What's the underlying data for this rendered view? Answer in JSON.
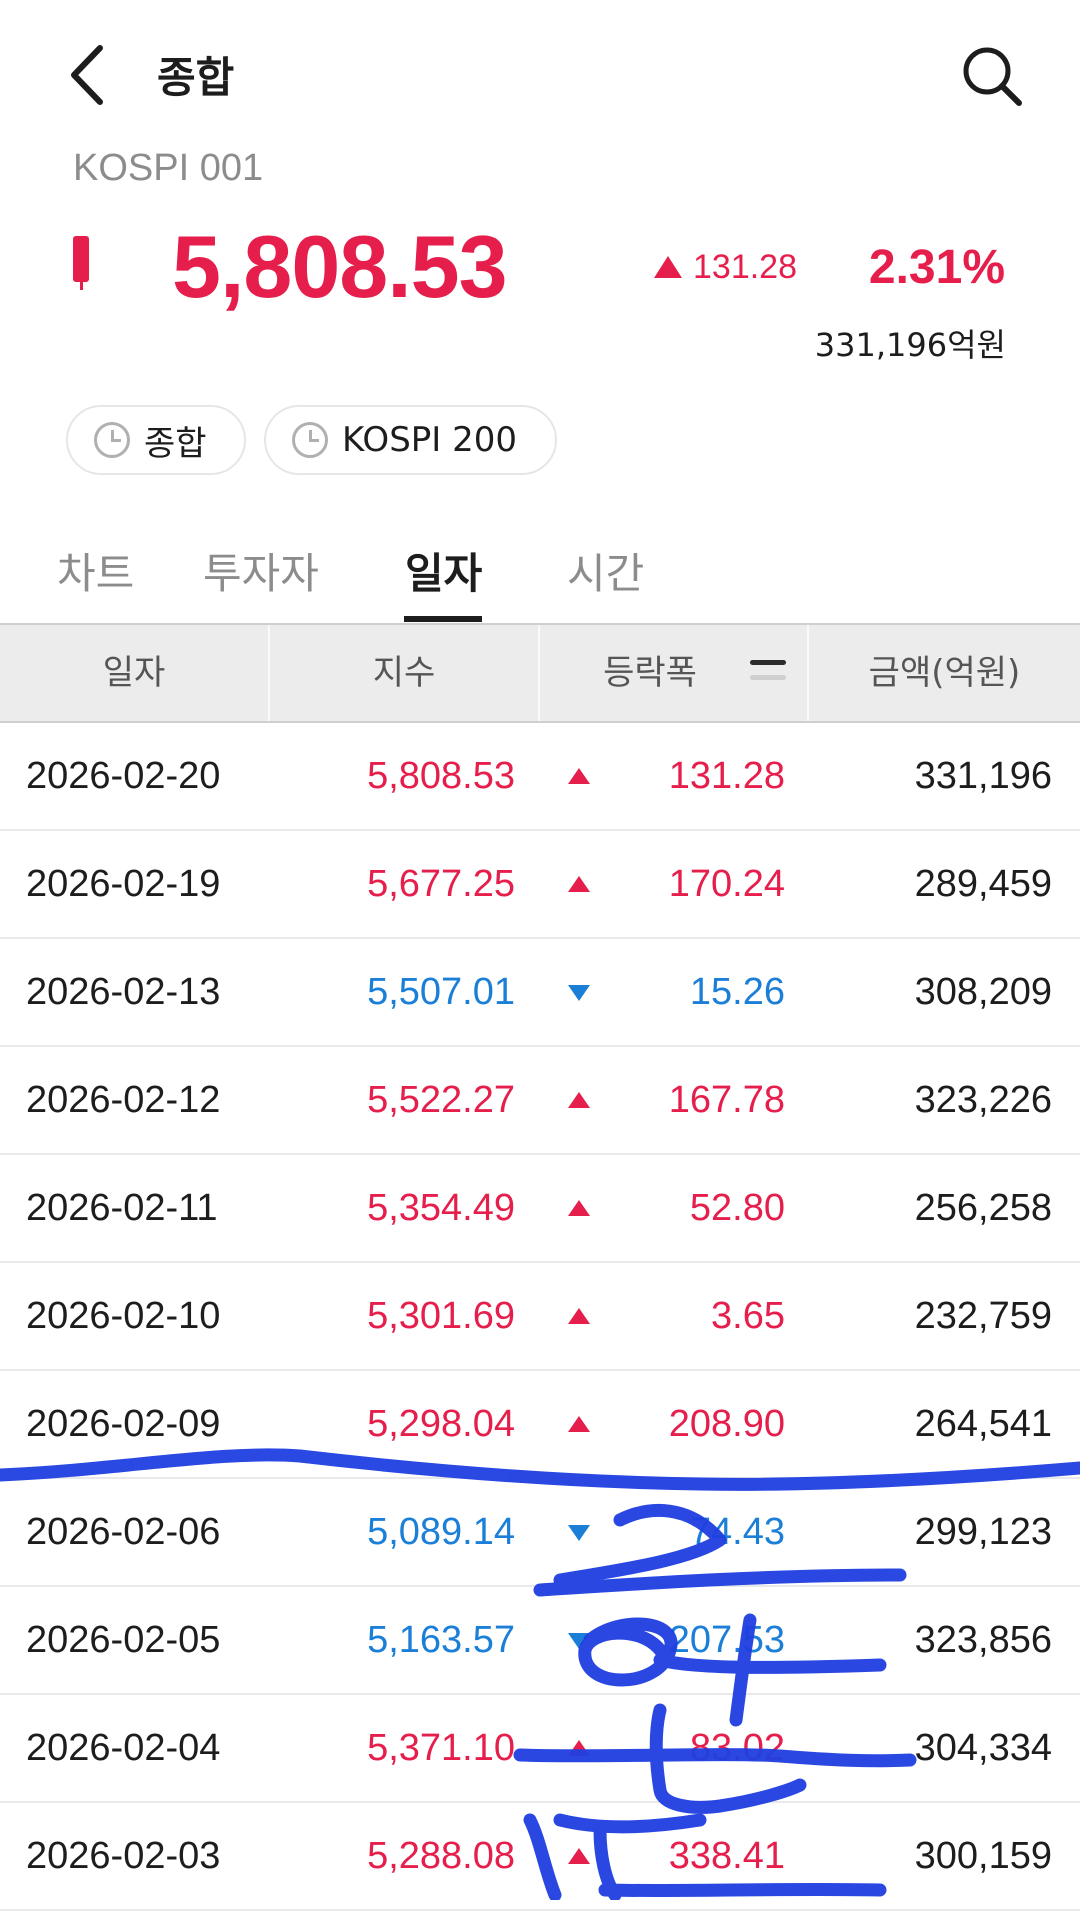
{
  "header": {
    "title": "종합",
    "back_icon": "chevron-left-icon",
    "search_icon": "search-icon"
  },
  "index": {
    "code": "KOSPI 001",
    "price": "5,808.53",
    "change": "131.28",
    "change_pct": "2.31%",
    "volume": "331,196억원",
    "direction": "up"
  },
  "chips": [
    {
      "label": "종합",
      "icon": "clock-icon"
    },
    {
      "label": "KOSPI 200",
      "icon": "clock-icon"
    }
  ],
  "tabs": [
    {
      "label": "차트",
      "active": false
    },
    {
      "label": "투자자",
      "active": false
    },
    {
      "label": "일자",
      "active": true
    },
    {
      "label": "시간",
      "active": false
    }
  ],
  "table": {
    "columns": [
      "일자",
      "지수",
      "등락폭",
      "금액(억원)"
    ],
    "rows": [
      {
        "date": "2026-02-20",
        "index": "5,808.53",
        "dir": "up",
        "change": "131.28",
        "amount": "331,196"
      },
      {
        "date": "2026-02-19",
        "index": "5,677.25",
        "dir": "up",
        "change": "170.24",
        "amount": "289,459"
      },
      {
        "date": "2026-02-13",
        "index": "5,507.01",
        "dir": "down",
        "change": "15.26",
        "amount": "308,209"
      },
      {
        "date": "2026-02-12",
        "index": "5,522.27",
        "dir": "up",
        "change": "167.78",
        "amount": "323,226"
      },
      {
        "date": "2026-02-11",
        "index": "5,354.49",
        "dir": "up",
        "change": "52.80",
        "amount": "256,258"
      },
      {
        "date": "2026-02-10",
        "index": "5,301.69",
        "dir": "up",
        "change": "3.65",
        "amount": "232,759"
      },
      {
        "date": "2026-02-09",
        "index": "5,298.04",
        "dir": "up",
        "change": "208.90",
        "amount": "264,541"
      },
      {
        "date": "2026-02-06",
        "index": "5,089.14",
        "dir": "down",
        "change": "74.43",
        "amount": "299,123"
      },
      {
        "date": "2026-02-05",
        "index": "5,163.57",
        "dir": "down",
        "change": "207.53",
        "amount": "323,856"
      },
      {
        "date": "2026-02-04",
        "index": "5,371.10",
        "dir": "up",
        "change": "83.02",
        "amount": "304,334"
      },
      {
        "date": "2026-02-03",
        "index": "5,288.08",
        "dir": "up",
        "change": "338.41",
        "amount": "300,159"
      }
    ]
  },
  "colors": {
    "up": "#e61e4b",
    "down": "#1b7fd8",
    "annotation": "#1f3fe0"
  }
}
